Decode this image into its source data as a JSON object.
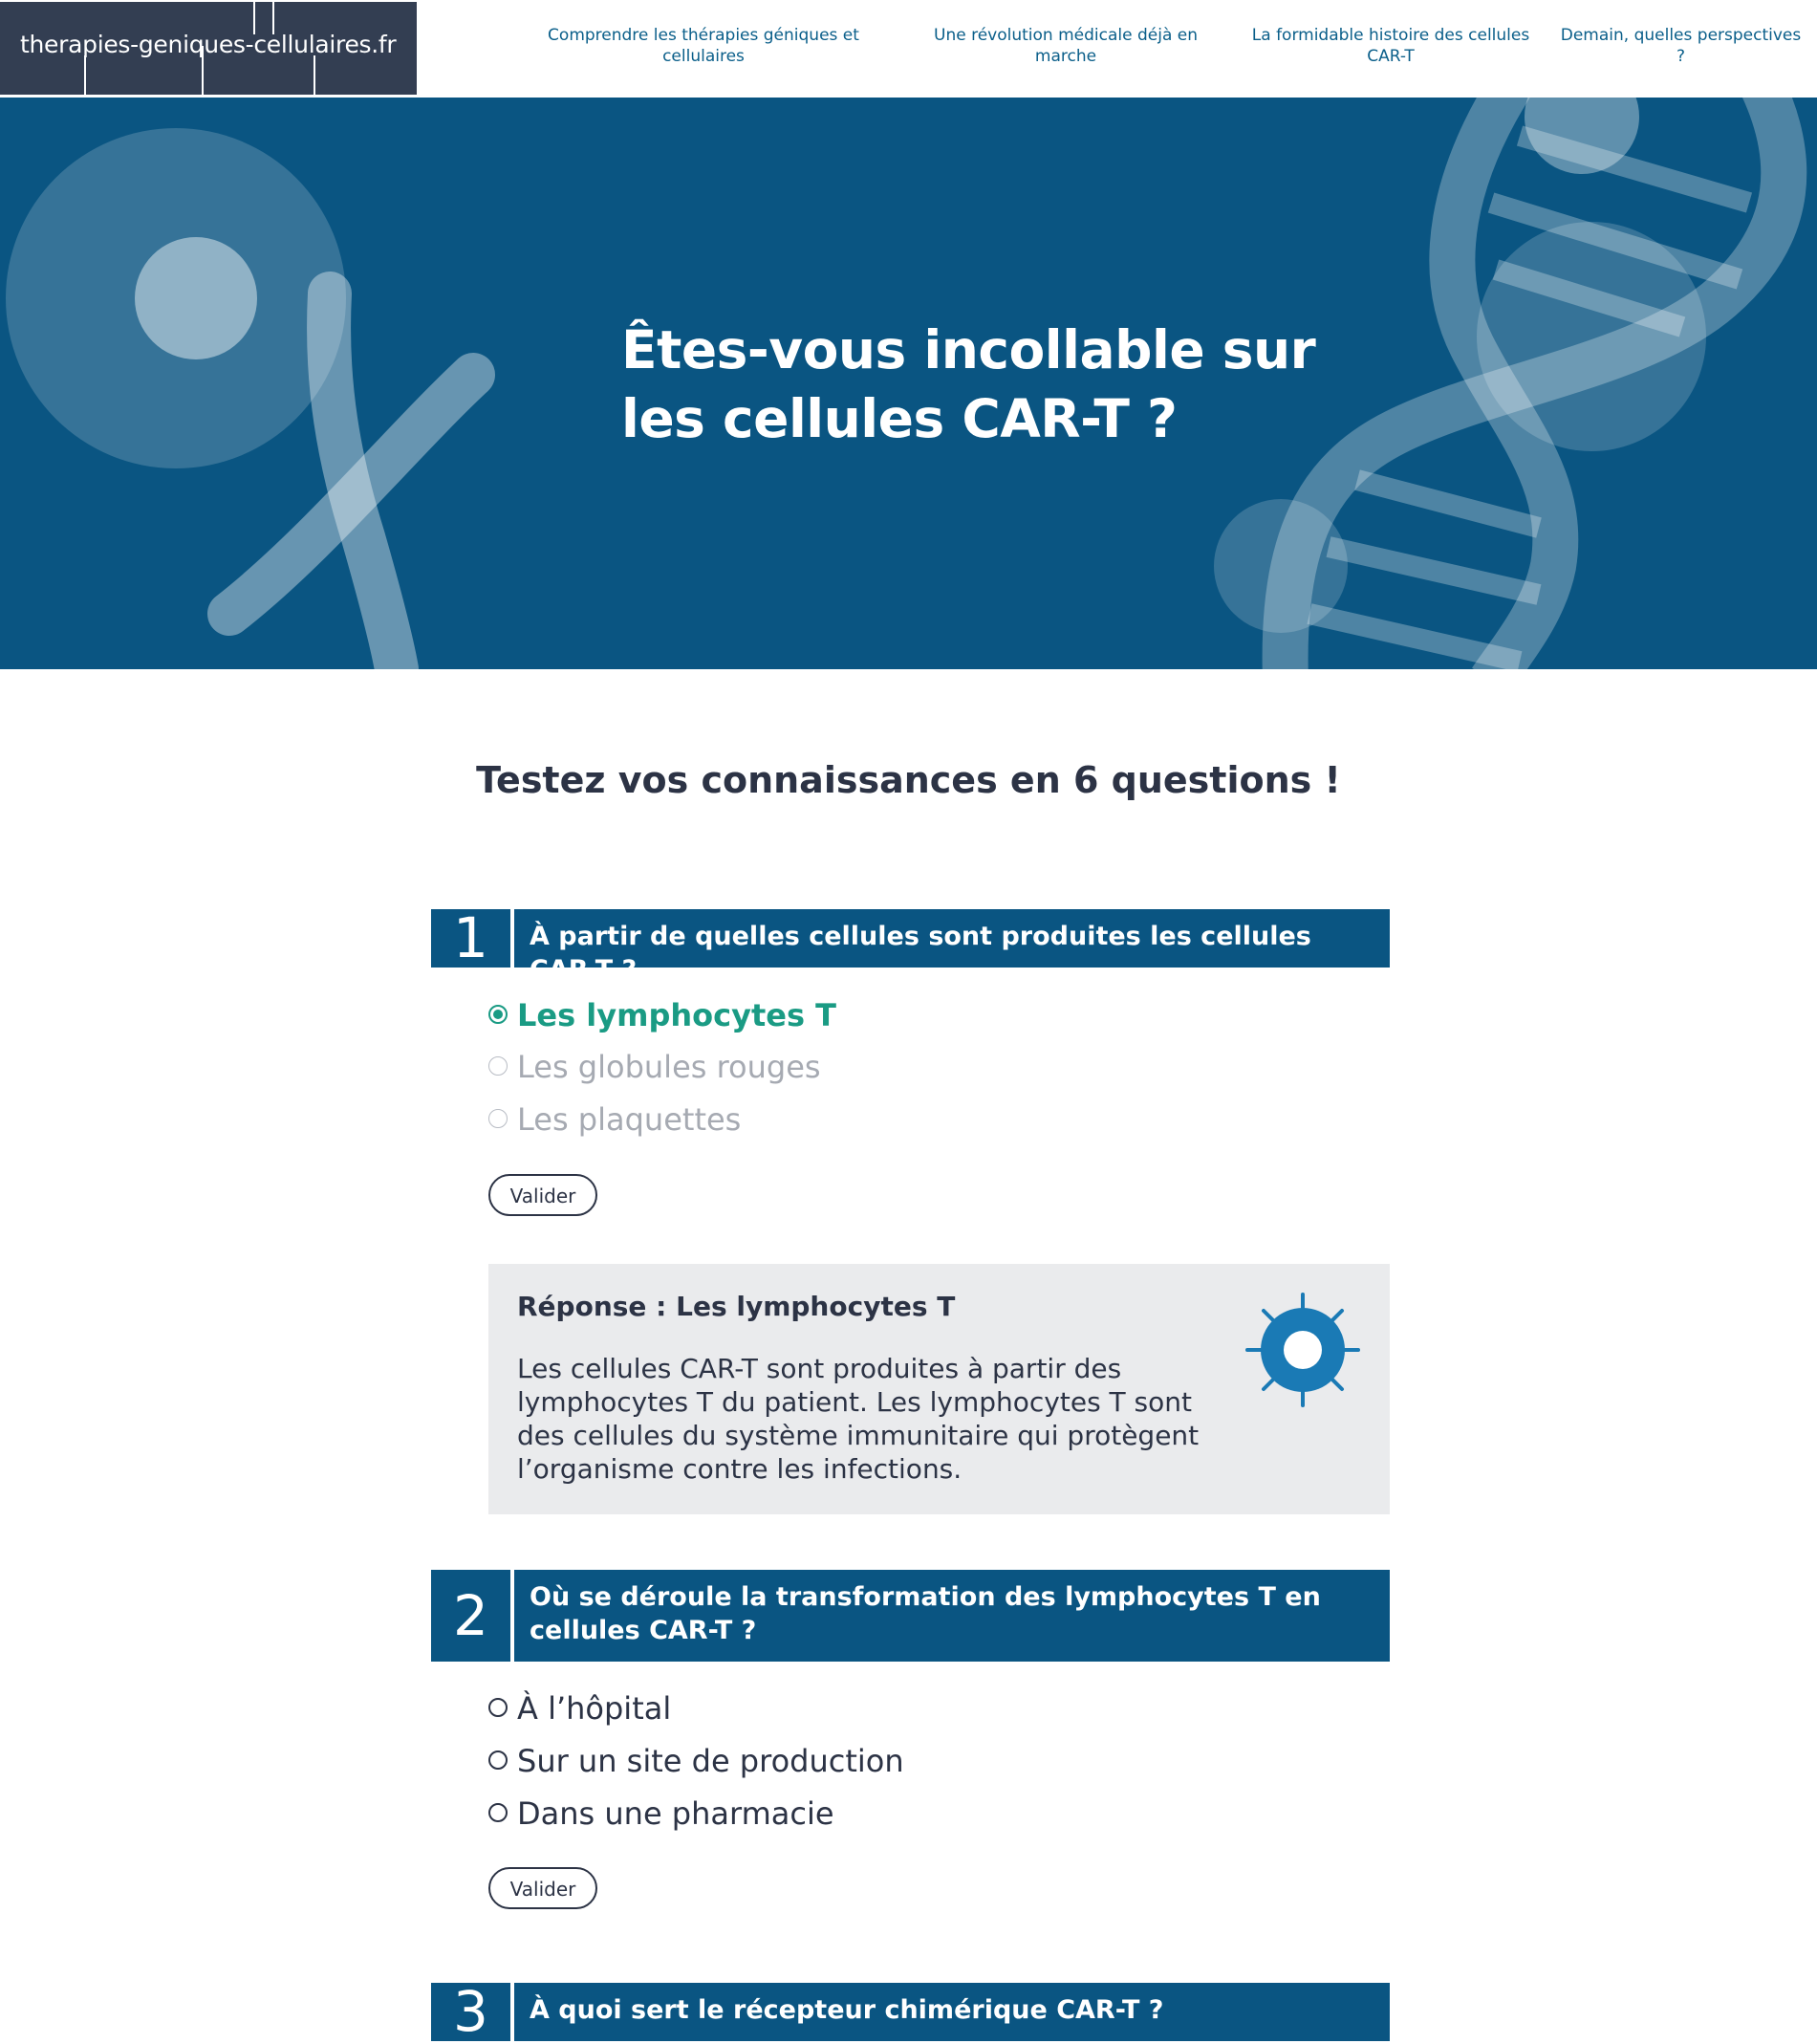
{
  "site": {
    "logo_text": "therapies-geniques-cellulaires.fr"
  },
  "nav": [
    {
      "label": "Comprendre les thérapies géniques et cellulaires"
    },
    {
      "label": "Une révolution médicale déjà en marche"
    },
    {
      "label": "La formidable histoire des cellules CAR-T"
    },
    {
      "label": "Demain, quelles perspectives ?"
    }
  ],
  "hero": {
    "title": "Êtes-vous incollable sur les cellules CAR-T ?"
  },
  "quiz": {
    "subtitle": "Testez vos connaissances en 6 questions !",
    "questions": [
      {
        "number": "1",
        "text": "À partir de quelles cellules sont produites les cellules CAR-T ?",
        "options": [
          {
            "label": "Les lymphocytes T",
            "state": "correct"
          },
          {
            "label": "Les globules rouges",
            "state": "dim"
          },
          {
            "label": "Les plaquettes",
            "state": "dim"
          }
        ],
        "submit_label": "Valider",
        "answer": {
          "title": "Réponse : Les lymphocytes T",
          "body": "Les cellules CAR-T sont produites à partir des lymphocytes T du patient. Les lymphocytes T sont des cellules du système immunitaire qui protègent l’organisme contre les infections.",
          "icon": "lymphocyte-icon"
        }
      },
      {
        "number": "2",
        "text": "Où se déroule la transformation des lymphocytes T en cellules CAR-T ?",
        "options": [
          {
            "label": "À l’hôpital",
            "state": "default"
          },
          {
            "label": "Sur un site de production",
            "state": "default"
          },
          {
            "label": "Dans une pharmacie",
            "state": "default"
          }
        ],
        "submit_label": "Valider"
      },
      {
        "number": "3",
        "text": "À quoi sert le récepteur chimérique CAR-T ?"
      }
    ]
  },
  "colors": {
    "primary_blue": "#0a5582",
    "logo_bg": "#333e52",
    "correct_green": "#1a9b84",
    "answer_bg": "#eaebed",
    "icon_blue": "#1a7ab5"
  }
}
